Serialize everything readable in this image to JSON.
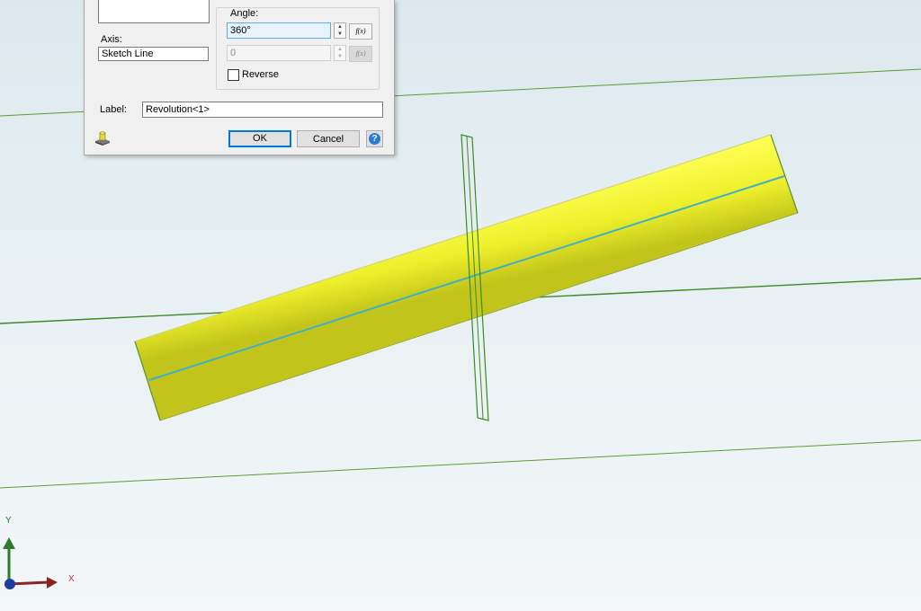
{
  "viewport": {
    "colors": {
      "cylinder_fill": "#ecef2c",
      "cylinder_dark": "#c6c61a",
      "axis_line": "#3fb0c8",
      "sketch_line": "#56a032",
      "plane_outline": "#3d8a26"
    },
    "triad": {
      "x_label": "X",
      "y_label": "Y",
      "x_color": "#8a2323",
      "y_color": "#2f7a2f",
      "origin_color": "#1f3ea0"
    }
  },
  "dialog": {
    "axis_label": "Axis:",
    "axis_value": "Sketch Line",
    "angle_group_title": "Angle:",
    "angle_value": "360°",
    "second_angle_value": "0",
    "fx_label": "f(x)",
    "reverse_label": "Reverse",
    "label_caption": "Label:",
    "label_value": "Revolution<1>",
    "ok_label": "OK",
    "cancel_label": "Cancel",
    "help_glyph": "?",
    "part_icon": "part-icon"
  }
}
